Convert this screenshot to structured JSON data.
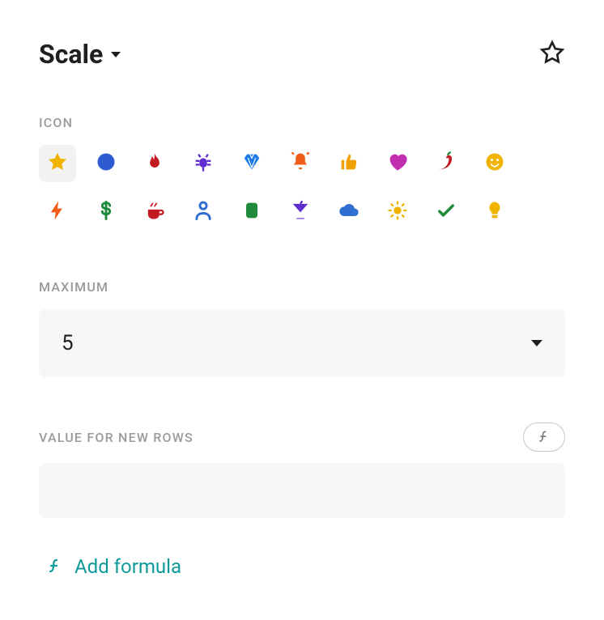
{
  "header": {
    "title": "Scale"
  },
  "iconSection": {
    "label": "Icon",
    "selected": 0,
    "items": [
      {
        "name": "star",
        "color": "#f0b400"
      },
      {
        "name": "circle",
        "color": "#2f5bd1"
      },
      {
        "name": "fire",
        "color": "#c31a21"
      },
      {
        "name": "bug",
        "color": "#5f2dcf"
      },
      {
        "name": "diamond",
        "color": "#1a78e6"
      },
      {
        "name": "bell",
        "color": "#f25c19"
      },
      {
        "name": "thumbs-up",
        "color": "#f0a000"
      },
      {
        "name": "heart",
        "color": "#c22eb0"
      },
      {
        "name": "chili",
        "color": "#c31a21"
      },
      {
        "name": "smile",
        "color": "#f0b400"
      },
      {
        "name": "bolt",
        "color": "#f25c19"
      },
      {
        "name": "dollar",
        "color": "#1f8a3a"
      },
      {
        "name": "coffee",
        "color": "#c31a21"
      },
      {
        "name": "person",
        "color": "#2f6fd1"
      },
      {
        "name": "card",
        "color": "#1f8a3a"
      },
      {
        "name": "cocktail",
        "color": "#5f2dcf"
      },
      {
        "name": "cloud",
        "color": "#2f6fd1"
      },
      {
        "name": "sun",
        "color": "#f0b400"
      },
      {
        "name": "check",
        "color": "#1f8a3a"
      },
      {
        "name": "bulb",
        "color": "#f0b400"
      }
    ]
  },
  "maximum": {
    "label": "Maximum",
    "value": "5"
  },
  "valueForNewRows": {
    "label": "Value for new rows",
    "value": ""
  },
  "addFormula": {
    "label": "Add formula"
  }
}
